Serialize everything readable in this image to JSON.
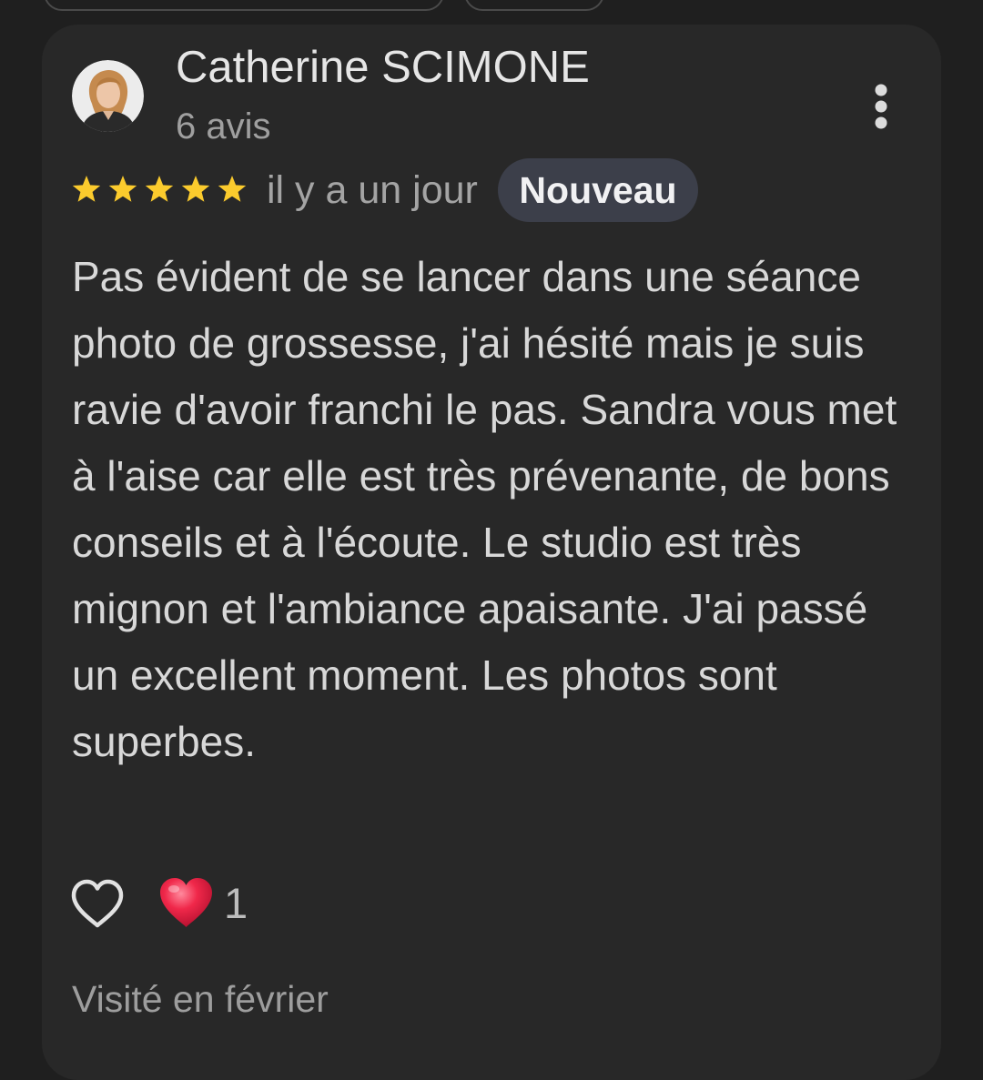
{
  "review": {
    "author_name": "Catherine SCIMONE",
    "author_review_count": "6 avis",
    "rating": 5,
    "rating_max": 5,
    "time_ago": "il y a un jour",
    "badge": "Nouveau",
    "text": "Pas évident de se lancer dans une séance photo de grossesse, j'ai hésité mais je suis ravie d'avoir franchi le pas. Sandra vous met à l'aise car elle est très prévenante, de bons conseils et à l'écoute. Le studio est très mignon et l'ambiance apaisante. J'ai passé un excellent moment. Les photos sont superbes.",
    "reaction_count": "1",
    "visit_date": "Visité en février"
  },
  "icons": {
    "menu": "more-vert-icon",
    "star": "star-icon",
    "like": "heart-outline-icon",
    "reaction": "red-heart-emoji-icon"
  },
  "colors": {
    "background": "#1f1f1f",
    "card": "#282828",
    "star": "#fbcb2d",
    "badge_bg": "#3c3f4a",
    "heart": "#f0284a"
  }
}
